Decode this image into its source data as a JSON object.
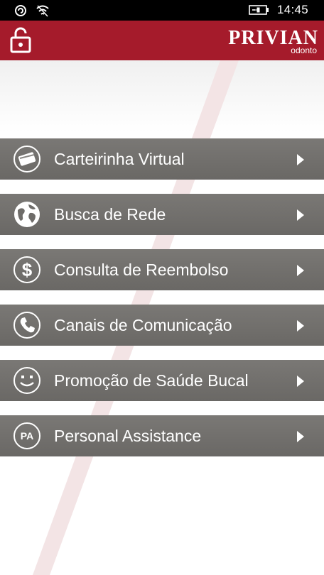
{
  "status_bar": {
    "time": "14:45",
    "icons": [
      "sync-icon",
      "wifi-icon",
      "battery-charging-icon"
    ]
  },
  "header": {
    "lock_icon": "lock-icon",
    "logo_text": "PRIVIAN",
    "logo_sub": "odonto",
    "bg_color": "#a51b2b"
  },
  "menu": {
    "items": [
      {
        "label": "Carteirinha Virtual",
        "icon": "card-icon"
      },
      {
        "label": "Busca de Rede",
        "icon": "globe-icon"
      },
      {
        "label": "Consulta de Reembolso",
        "icon": "dollar-icon"
      },
      {
        "label": "Canais de Comunicação",
        "icon": "phone-icon"
      },
      {
        "label": "Promoção de Saúde Bucal",
        "icon": "smile-icon"
      },
      {
        "label": "Personal Assistance",
        "icon": "pa-icon",
        "icon_text": "PA"
      }
    ]
  }
}
